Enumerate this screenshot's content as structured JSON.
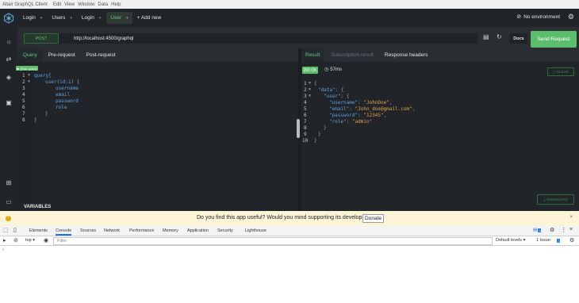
{
  "menubar": {
    "title": "Altair GraphQL Client",
    "items": [
      "Edit",
      "View",
      "Window",
      "Data",
      "Help"
    ]
  },
  "window_tabs": {
    "tabs": [
      {
        "label": "Login",
        "active": false
      },
      {
        "label": "Users",
        "active": false
      },
      {
        "label": "Login",
        "active": false
      },
      {
        "label": "User",
        "active": true
      }
    ],
    "add_new_label": "+ Add new",
    "environment_label": "No environment"
  },
  "request": {
    "method": "POST",
    "url": "http://localhost:4500/graphql",
    "docs_label": "Docs",
    "send_label": "Send Request"
  },
  "query_pane": {
    "tabs": [
      "Query",
      "Pre-request",
      "Post-request"
    ],
    "active_tab": "Query",
    "run_query_label": "▶ (Run query)",
    "line_numbers": [
      "1",
      "2",
      "3",
      "4",
      "5",
      "6",
      "7",
      "8"
    ],
    "lines": {
      "l1": "query{",
      "l2_a": "user",
      "l2_b": "(",
      "l2_c": "id",
      "l2_d": ":",
      "l2_e": "1",
      "l2_f": ") {",
      "l3": "username",
      "l4": "email",
      "l5": "password",
      "l6": "role",
      "l7": "}",
      "l8": "}"
    },
    "variables_label": "VARIABLES"
  },
  "result_pane": {
    "tabs": [
      "Result",
      "Subscription result",
      "Response headers"
    ],
    "active_tab": "Result",
    "status": "200 OK",
    "timing": "57ms",
    "clear_label": "CLEAR",
    "download_label": "DOWNLOAD",
    "line_numbers": [
      "1",
      "2",
      "3",
      "4",
      "5",
      "6",
      "7",
      "8",
      "9",
      "10"
    ],
    "json": {
      "l1": "{",
      "l2_key": "\"data\"",
      "l2_rest": ": {",
      "l3_key": "\"user\"",
      "l3_rest": ": {",
      "l4_key": "\"username\"",
      "l4_val": "\"JohnDoe\"",
      "l5_key": "\"email\"",
      "l5_val": "\"John_doe@gmail.com\"",
      "l6_key": "\"password\"",
      "l6_val": "\"12345\"",
      "l7_key": "\"role\"",
      "l7_val": "\"admin\"",
      "l8": "}",
      "l9": "}",
      "l10": "}"
    }
  },
  "notification": {
    "message": "Do you find this app useful? Would you mind supporting its development?",
    "donate_label": "Donate",
    "close_label": "×"
  },
  "devtools": {
    "tabs": [
      "Elements",
      "Console",
      "Sources",
      "Network",
      "Performance",
      "Memory",
      "Application",
      "Security",
      "Lighthouse"
    ],
    "active_tab": "Console",
    "messages_badge": "1",
    "context": "top",
    "filter_placeholder": "Filter",
    "levels": "Default levels",
    "issues_label": "1 Issue:",
    "issues_badge": "1",
    "prompt": "›"
  },
  "colors": {
    "accent_green": "#5cbd6c",
    "background_dark": "#212428",
    "notification_bg": "#fcf4d6",
    "link_blue": "#1a73e8"
  }
}
